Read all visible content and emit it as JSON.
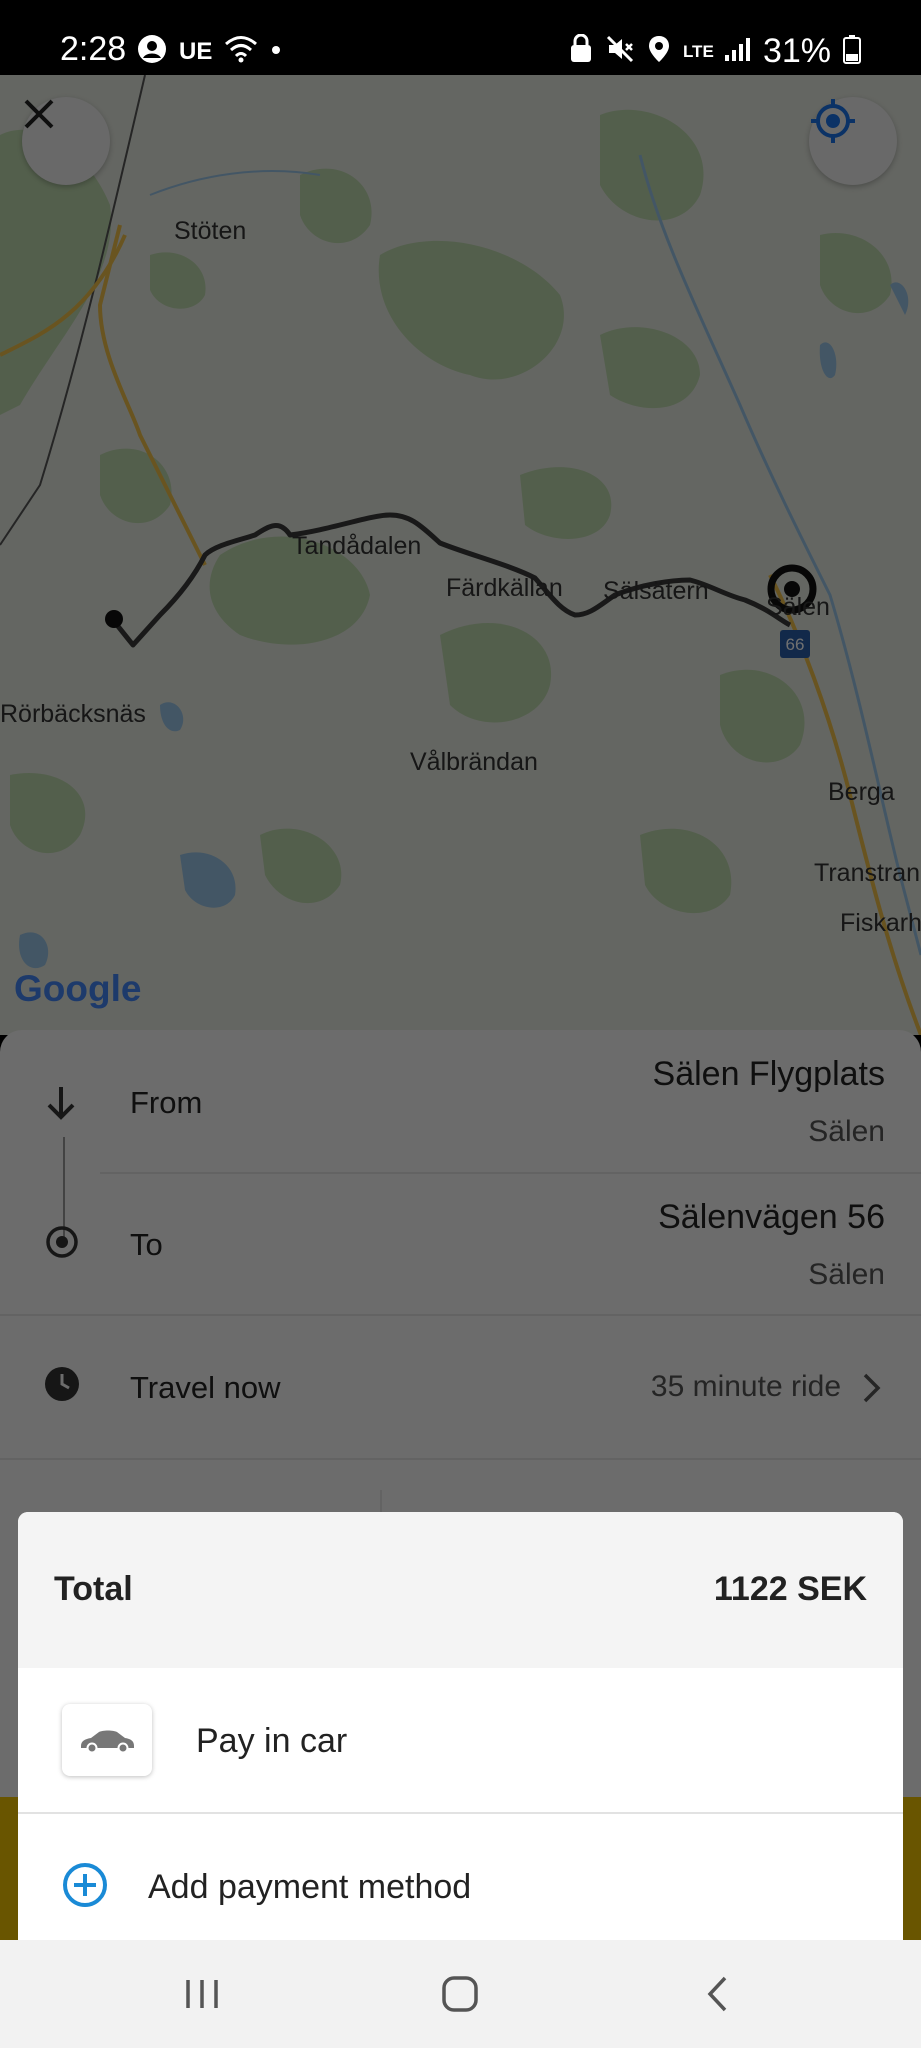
{
  "status_bar": {
    "time": "2:28",
    "carrier_badge": "UE",
    "network": "LTE",
    "battery": "31%",
    "icons_left": [
      "account-circle-icon",
      "ue-icon",
      "wifi-icon",
      "dot-icon"
    ],
    "icons_right": [
      "lock-icon",
      "mute-icon",
      "location-icon",
      "lte-icon",
      "signal-icon",
      "battery-icon"
    ]
  },
  "map": {
    "labels": {
      "stoten": "Stöten",
      "tandadalen": "Tandådalen",
      "fardkallan": "Färdkällan",
      "salsatern": "Sälsätern",
      "salen": "Sälen",
      "rorbacksnas": "Rörbäcksnäs",
      "valbrandan": "Vålbrändan",
      "berga": "Berga",
      "transtrand": "Transtran",
      "fiskarheden": "Fiskarh"
    },
    "road_shield": "66",
    "attribution": "Google",
    "colors": {
      "route": "#3a3a3a",
      "water": "#9ac7e8",
      "forest": "#b7d8a8",
      "road": "#f2c34a"
    }
  },
  "trip": {
    "from_label": "From",
    "from_place": "Sälen Flygplats",
    "from_area": "Sälen",
    "to_label": "To",
    "to_place": "Sälenvägen 56",
    "to_area": "Sälen",
    "time_label": "Travel now",
    "duration": "35 minute ride"
  },
  "payment": {
    "total_label": "Total",
    "total_value": "1122 SEK",
    "pay_in_car_label": "Pay in car",
    "add_method_label": "Add payment method",
    "accent_color": "#1a8ad6"
  },
  "nav": {
    "icons": [
      "recents-icon",
      "home-icon",
      "back-icon"
    ]
  }
}
